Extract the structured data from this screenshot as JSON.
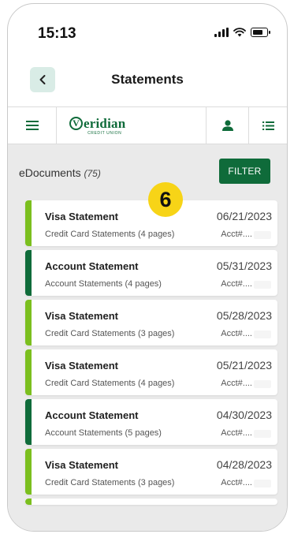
{
  "status_bar": {
    "time": "15:13"
  },
  "header": {
    "title": "Statements"
  },
  "nav": {
    "logo_text": "eridian",
    "logo_initial": "V",
    "logo_sub": "CREDIT UNION"
  },
  "documents": {
    "label": "eDocuments",
    "count": "(75)"
  },
  "filter_label": "FILTER",
  "step_badge": "6",
  "statements": [
    {
      "kind": "visa",
      "title": "Visa Statement",
      "subtitle": "Credit Card Statements (4 pages)",
      "date": "06/21/2023",
      "acct": "Acct#...."
    },
    {
      "kind": "account",
      "title": "Account Statement",
      "subtitle": "Account Statements (4 pages)",
      "date": "05/31/2023",
      "acct": "Acct#...."
    },
    {
      "kind": "visa",
      "title": "Visa Statement",
      "subtitle": "Credit Card Statements (3 pages)",
      "date": "05/28/2023",
      "acct": "Acct#...."
    },
    {
      "kind": "visa",
      "title": "Visa Statement",
      "subtitle": "Credit Card Statements (4 pages)",
      "date": "05/21/2023",
      "acct": "Acct#...."
    },
    {
      "kind": "account",
      "title": "Account Statement",
      "subtitle": "Account Statements (5 pages)",
      "date": "04/30/2023",
      "acct": "Acct#...."
    },
    {
      "kind": "visa",
      "title": "Visa Statement",
      "subtitle": "Credit Card Statements (3 pages)",
      "date": "04/28/2023",
      "acct": "Acct#...."
    }
  ],
  "colors": {
    "brand_green": "#0f6b3a",
    "visa_green": "#7bbf1e",
    "badge_yellow": "#f7d417"
  }
}
